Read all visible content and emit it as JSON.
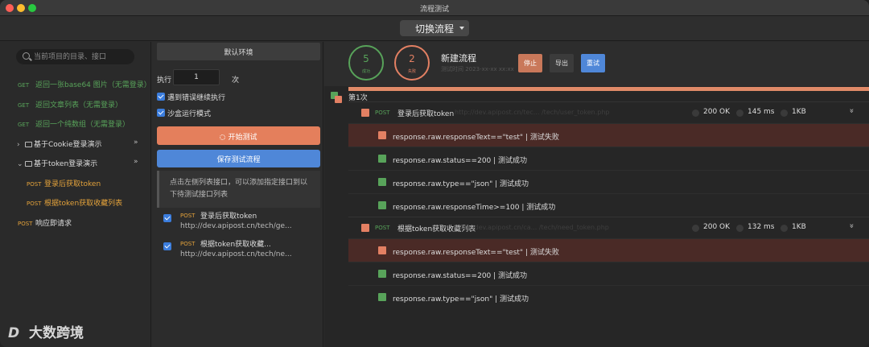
{
  "window": {
    "title": "流程测试",
    "traffic_colors": [
      "#fe5f57",
      "#febc2e",
      "#28c840"
    ]
  },
  "toolbar": {
    "switch_label": "切换流程"
  },
  "sidebar": {
    "search_placeholder": "当前项目的目录、接口",
    "items": [
      {
        "method": "GET",
        "label": "返回一张base64 图片（无需登录）",
        "color": "#58a35a"
      },
      {
        "method": "GET",
        "label": "返回文章列表（无需登录）",
        "color": "#58a35a"
      },
      {
        "method": "GET",
        "label": "返回一个纯数组（无需登录）",
        "color": "#58a35a"
      }
    ],
    "folders": [
      {
        "label": "基于Cookie登录演示",
        "chevron": "›",
        "more": "»"
      },
      {
        "label": "基于token登录演示",
        "chevron": "⌄",
        "more": "»"
      }
    ],
    "sub_items": [
      {
        "method": "POST",
        "label": "登录后获取token"
      },
      {
        "method": "POST",
        "label": "根据token获取收藏列表"
      }
    ],
    "last_item": {
      "method": "POST",
      "label": "响应即请求"
    },
    "post_color": "#e3a23b"
  },
  "middle": {
    "env_label": "默认环境",
    "exec_label": "执行",
    "exec_value": "1",
    "exec_unit": "次",
    "opt1": "遇到错误继续执行",
    "opt2": "沙盒运行模式",
    "start_label": "开始测试",
    "start_icon": "loading-icon",
    "save_label": "保存测试流程",
    "hint": "点击左侧列表接口，可以添加指定接口到以下待测试接口列表",
    "cases": [
      {
        "method": "POST",
        "name": "登录后获取token",
        "url": "http://dev.apipost.cn/tech/ge..."
      },
      {
        "method": "POST",
        "name": "根据token获取收藏...",
        "url": "http://dev.apipost.cn/tech/ne..."
      }
    ]
  },
  "results": {
    "pass_count": "5",
    "pass_label": "成功",
    "fail_count": "2",
    "fail_label": "失败",
    "flow_title": "新建流程",
    "flow_sub": "测试时间 2023-xx-xx xx:xx",
    "stop_label": "停止",
    "export_label": "导出",
    "retest_label": "重试",
    "round_label": "第1次",
    "colors": {
      "pass": "#58a35a",
      "fail": "#e38063",
      "accent_blue": "#4f87d8"
    },
    "requests": [
      {
        "method": "POST",
        "name": "登录后获取token",
        "url": "http://dev.apipost.cn/tec...                /tech/user_token.php",
        "status": "200 OK",
        "time": "145 ms",
        "size": "1KB",
        "asserts": [
          {
            "text": "response.raw.responseText==\"test\" | 测试失败",
            "ok": false
          },
          {
            "text": "response.raw.status==200 | 测试成功",
            "ok": true
          },
          {
            "text": "response.raw.type==\"json\" | 测试成功",
            "ok": true
          },
          {
            "text": "response.raw.responseTime>=100 | 测试成功",
            "ok": true
          }
        ]
      },
      {
        "method": "POST",
        "name": "根据token获取收藏列表",
        "url": "http://dev.apipost.cn/ca...                /tech/need_token.php",
        "status": "200 OK",
        "time": "132 ms",
        "size": "1KB",
        "asserts": [
          {
            "text": "response.raw.responseText==\"test\" | 测试失败",
            "ok": false
          },
          {
            "text": "response.raw.status==200 | 测试成功",
            "ok": true
          },
          {
            "text": "response.raw.type==\"json\" | 测试成功",
            "ok": true
          }
        ]
      }
    ]
  },
  "watermark": {
    "logo": "D",
    "text": "大数跨境"
  }
}
